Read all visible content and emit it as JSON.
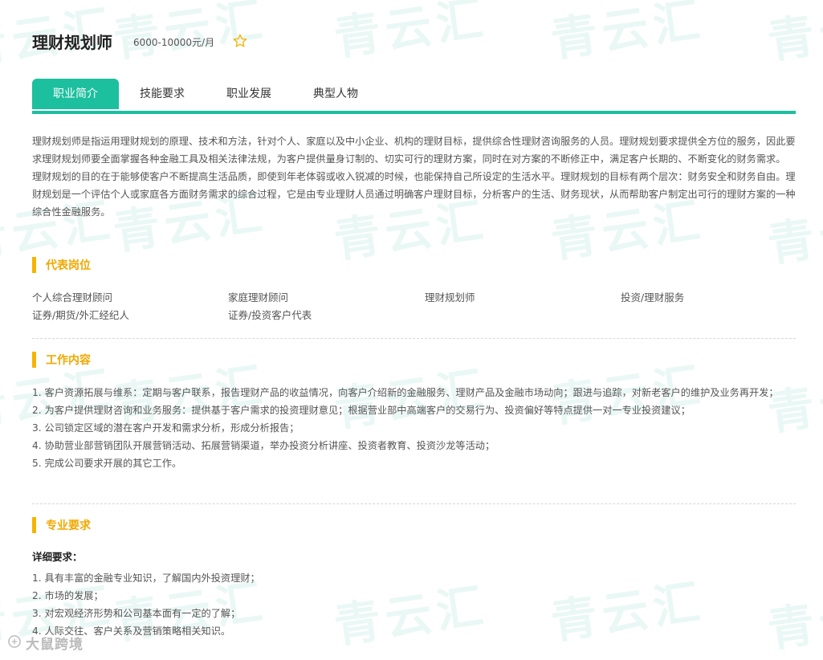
{
  "header": {
    "title": "理财规划师",
    "salary": "6000-10000元/月"
  },
  "icons": {
    "star": "star-outline-icon",
    "brand": "chat-bubble-icon"
  },
  "colors": {
    "accent": "#1cbf9e",
    "section": "#f5b400"
  },
  "tabs": [
    "职业简介",
    "技能要求",
    "职业发展",
    "典型人物"
  ],
  "intro": [
    "理财规划师是指运用理财规划的原理、技术和方法，针对个人、家庭以及中小企业、机构的理财目标，提供综合性理财咨询服务的人员。理财规划要求提供全方位的服务，因此要求理财规划师要全面掌握各种金融工具及相关法律法规，为客户提供量身订制的、切实可行的理财方案，同时在对方案的不断修正中，满足客户长期的、不断变化的财务需求。",
    "理财规划的目的在于能够使客户不断提高生活品质，即使到年老体弱或收入锐减的时候，也能保持自己所设定的生活水平。理财规划的目标有两个层次：财务安全和财务自由。理财规划是一个评估个人或家庭各方面财务需求的综合过程，它是由专业理财人员通过明确客户理财目标，分析客户的生活、财务现状，从而帮助客户制定出可行的理财方案的一种综合性金融服务。"
  ],
  "sections": {
    "positions": {
      "title": "代表岗位",
      "items": [
        "个人综合理财顾问",
        "家庭理财顾问",
        "理财规划师",
        "投资/理财服务",
        "证券/期货/外汇经纪人",
        "证券/投资客户代表"
      ]
    },
    "work": {
      "title": "工作内容",
      "items": [
        "1. 客户资源拓展与维系：定期与客户联系，报告理财产品的收益情况，向客户介绍新的金融服务、理财产品及金融市场动向；跟进与追踪，对新老客户的维护及业务再开发；",
        "2. 为客户提供理财咨询和业务服务：提供基于客户需求的投资理财意见；根据营业部中高端客户的交易行为、投资偏好等特点提供一对一专业投资建议；",
        "3. 公司锁定区域的潜在客户开发和需求分析，形成分析报告；",
        "4. 协助营业部营销团队开展营销活动、拓展营销渠道，举办投资分析讲座、投资者教育、投资沙龙等活动；",
        "5. 完成公司要求开展的其它工作。"
      ]
    },
    "requirements": {
      "title": "专业要求",
      "subheading": "详细要求：",
      "items": [
        "1. 具有丰富的金融专业知识，了解国内外投资理财；",
        "2. 市场的发展；",
        "3. 对宏观经济形势和公司基本面有一定的了解；",
        "4. 人际交往、客户关系及营销策略相关知识。"
      ]
    }
  },
  "watermark": "青云汇",
  "brand": "大鼠跨境"
}
